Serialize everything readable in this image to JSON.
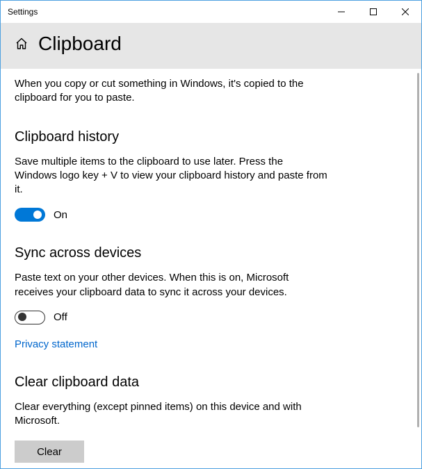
{
  "titlebar": {
    "title": "Settings"
  },
  "header": {
    "title": "Clipboard"
  },
  "intro": "When you copy or cut something in Windows, it's copied to the clipboard for you to paste.",
  "history": {
    "heading": "Clipboard history",
    "description": "Save multiple items to the clipboard to use later. Press the Windows logo key + V to view your clipboard history and paste from it.",
    "toggleLabel": "On"
  },
  "sync": {
    "heading": "Sync across devices",
    "description": "Paste text on your other devices. When this is on, Microsoft receives your clipboard data to sync it across your devices.",
    "toggleLabel": "Off"
  },
  "privacyLink": "Privacy statement",
  "clear": {
    "heading": "Clear clipboard data",
    "description": "Clear everything (except pinned items) on this device and with Microsoft.",
    "button": "Clear"
  }
}
